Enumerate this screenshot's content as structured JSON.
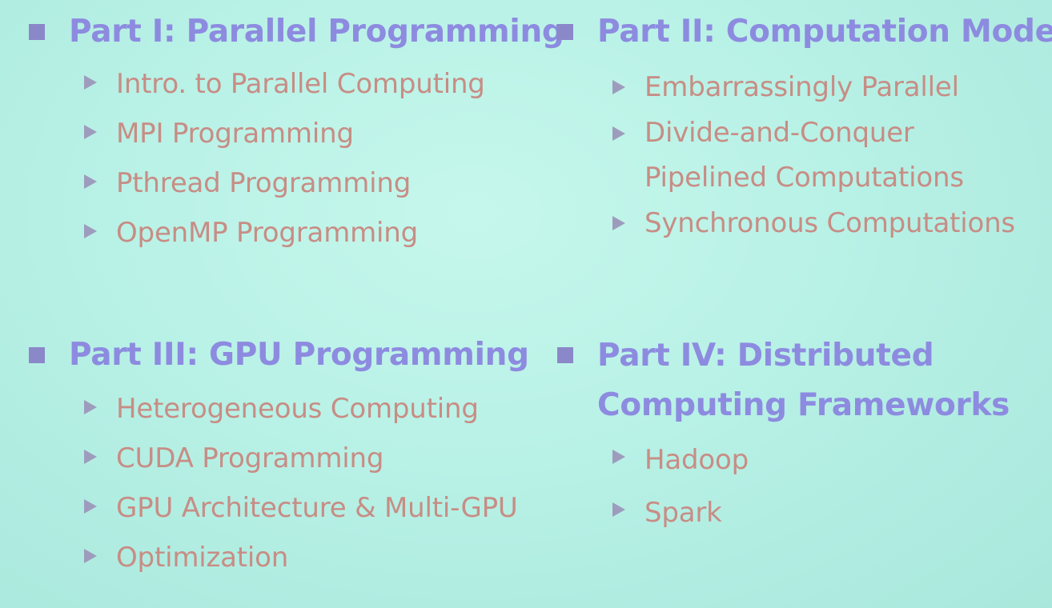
{
  "slide": {
    "sections": [
      {
        "heading": [
          "Part I: Parallel Programming"
        ],
        "items": [
          [
            "Intro. to Parallel Computing"
          ],
          [
            "MPI Programming"
          ],
          [
            "Pthread Programming"
          ],
          [
            "OpenMP Programming"
          ]
        ]
      },
      {
        "heading": [
          "Part II: Computation Model"
        ],
        "items": [
          [
            "Embarrassingly Parallel"
          ],
          [
            "Divide-and-Conquer",
            "Pipelined Computations"
          ],
          [
            "Synchronous Computations"
          ]
        ]
      },
      {
        "heading": [
          "Part III: GPU Programming"
        ],
        "items": [
          [
            "Heterogeneous Computing"
          ],
          [
            "CUDA Programming"
          ],
          [
            "GPU Architecture & Multi-GPU"
          ],
          [
            "Optimization"
          ]
        ]
      },
      {
        "heading": [
          "Part IV: Distributed",
          "Computing Frameworks"
        ],
        "items": [
          [
            "Hadoop"
          ],
          [
            "Spark"
          ]
        ]
      }
    ]
  },
  "colors": {
    "heading": "#8d8be0",
    "item_text": "#c78d85",
    "bullet_square": "#8a88c8",
    "arrow": "#9e9cbd",
    "background": "#b8f1e6"
  },
  "icons": {
    "section_bullet": "square-bullet-icon",
    "item_bullet": "arrow-bullet-icon"
  }
}
